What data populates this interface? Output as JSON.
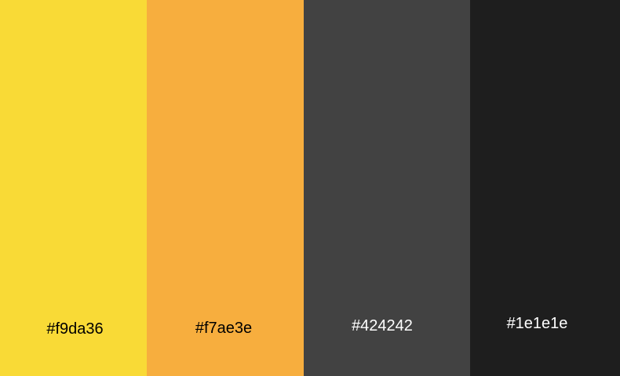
{
  "palette": {
    "swatches": [
      {
        "label": "#f9da36",
        "color": "#f9da36",
        "text_color": "#000000"
      },
      {
        "label": "#f7ae3e",
        "color": "#f7ae3e",
        "text_color": "#000000"
      },
      {
        "label": "#424242",
        "color": "#424242",
        "text_color": "#ffffff"
      },
      {
        "label": "#1e1e1e",
        "color": "#1e1e1e",
        "text_color": "#ffffff"
      }
    ]
  }
}
